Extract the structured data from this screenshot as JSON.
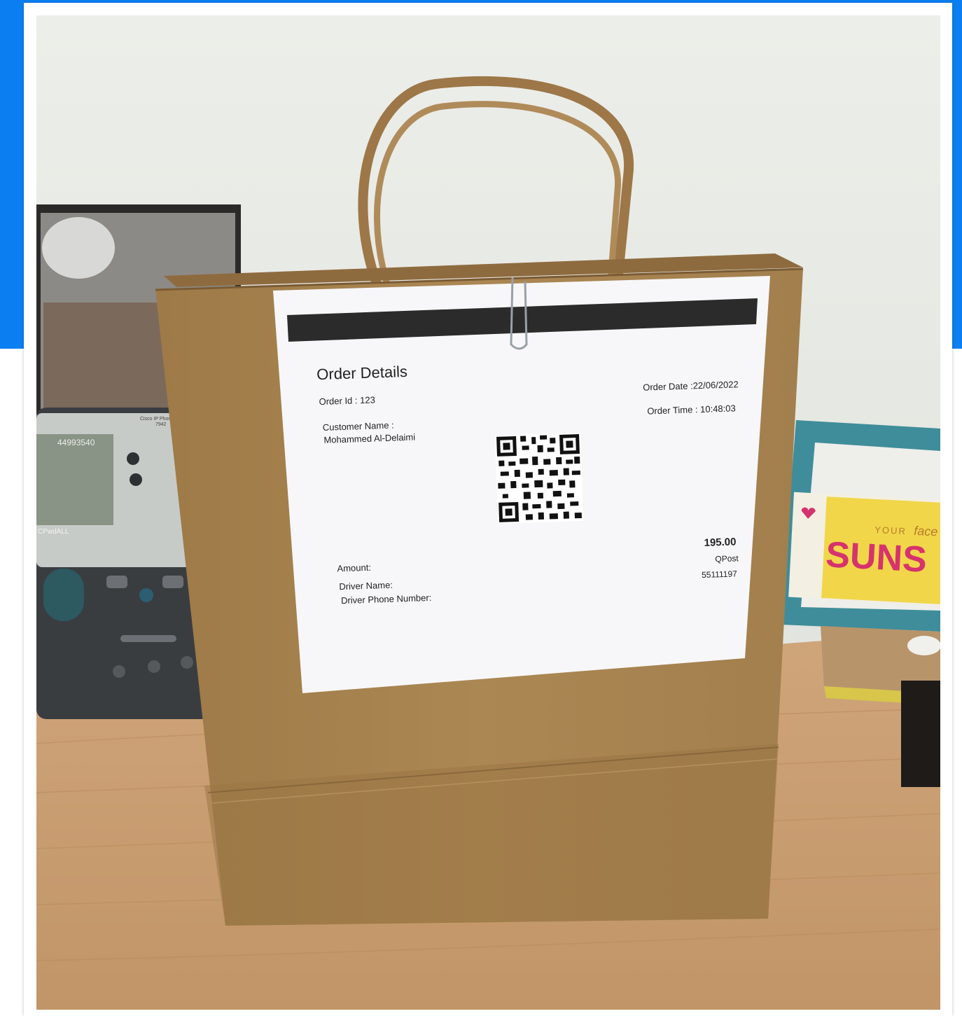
{
  "receipt": {
    "title": "Order Details",
    "order_id": "Order Id : 123",
    "customer_label": "Customer Name :",
    "customer_name": "Mohammed Al-Delaimi",
    "order_date": "Order Date :22/06/2022",
    "order_time": "Order Time :  10:48:03",
    "amount_value": "195.00",
    "courier": "QPost",
    "phone": "55111197",
    "amount_label": "Amount:",
    "driver_name_label": "Driver Name:",
    "driver_phone_label": "Driver Phone Number:"
  },
  "desk_phone": {
    "number": "44993540",
    "brand": "Cisco IP Phone",
    "model": "7942",
    "softkey": "CPwdALL"
  },
  "sticker": {
    "line1": "YOUR",
    "line1_script": "face",
    "line2": "SUNS"
  },
  "colors": {
    "header_blue": "#0b7ff2",
    "bag_kraft": "#a68454",
    "wall": "#e9ebe6",
    "desk_wood": "#c79e73",
    "frame_teal": "#3f8d9a",
    "sticker_yellow": "#f1d64a",
    "sticker_magenta": "#d6336c"
  }
}
